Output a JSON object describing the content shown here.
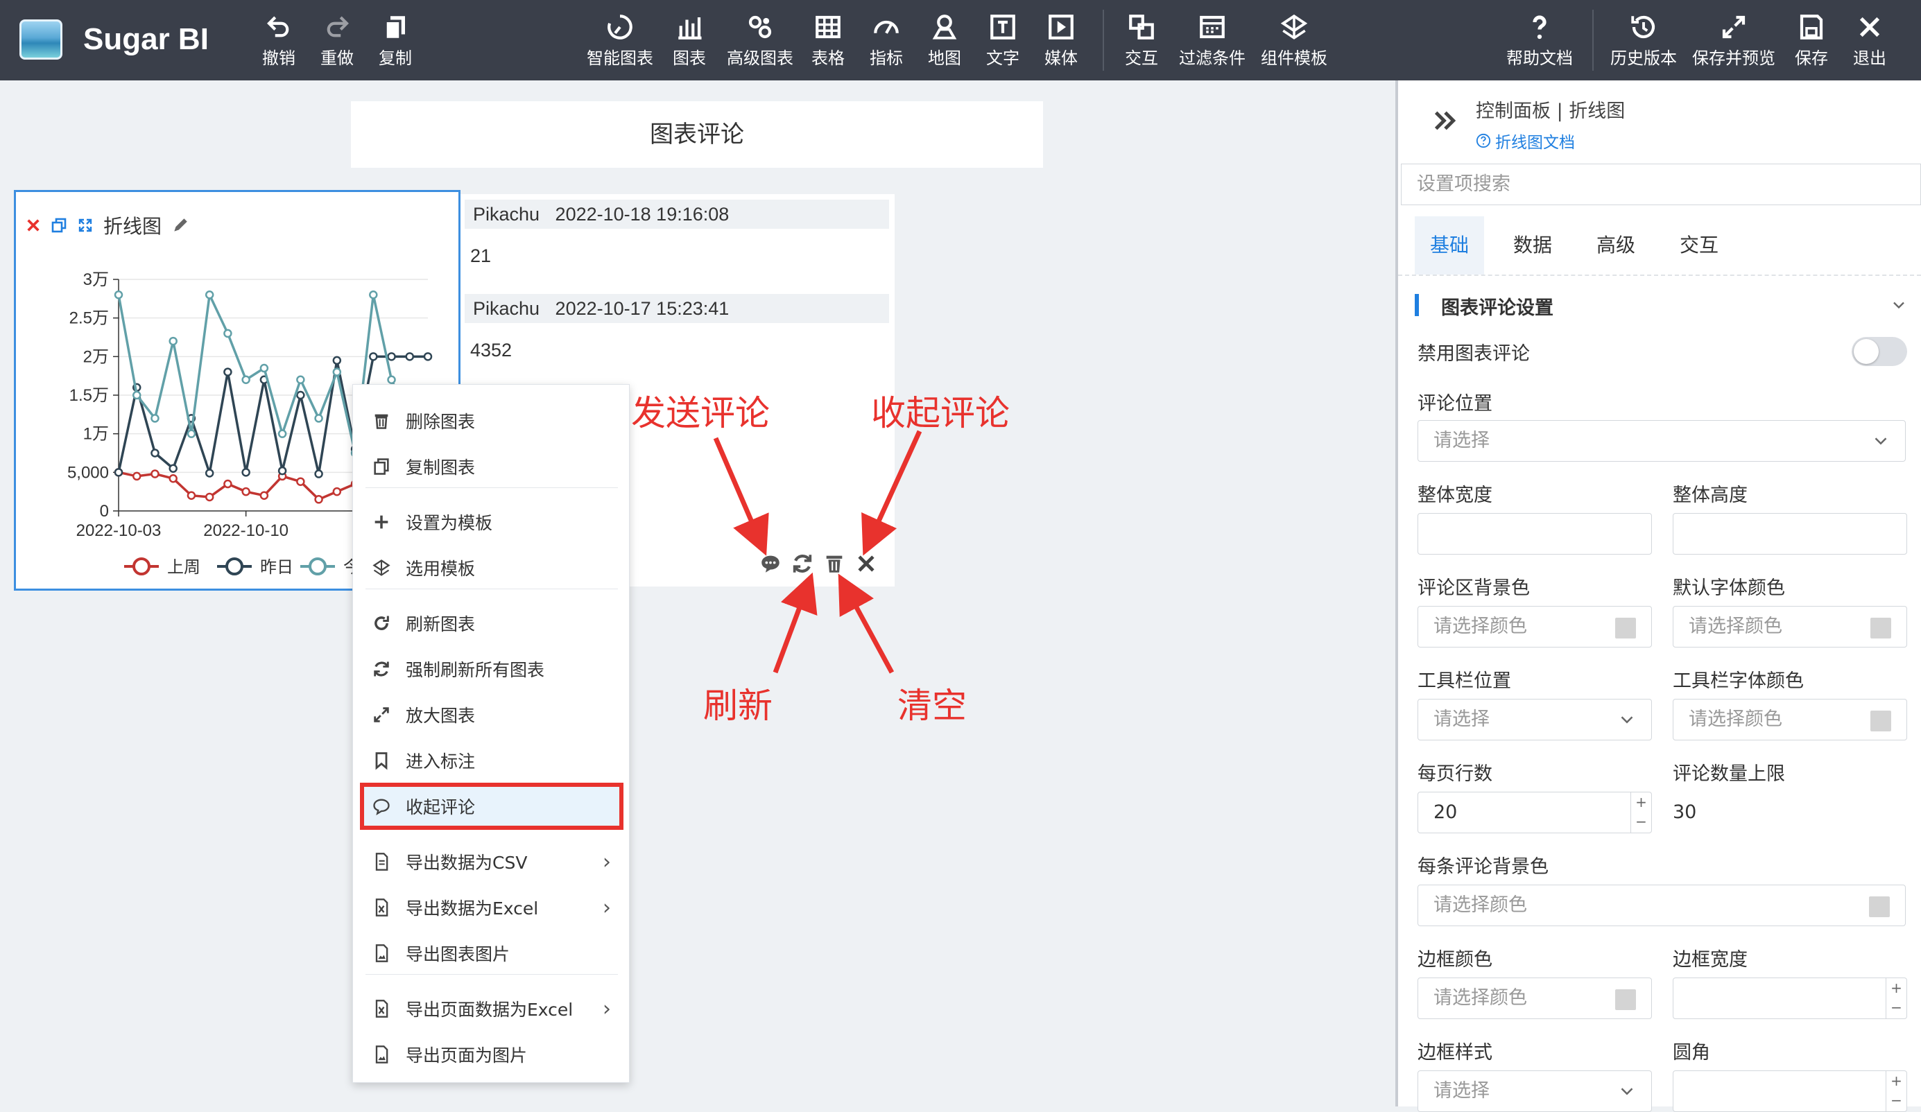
{
  "app": {
    "brand": "Sugar BI"
  },
  "toolbar": {
    "left": [
      {
        "label": "撤销",
        "icon": "undo-icon"
      },
      {
        "label": "重做",
        "icon": "redo-icon"
      },
      {
        "label": "复制",
        "icon": "copy-icon"
      }
    ],
    "center": [
      {
        "label": "智能图表",
        "icon": "smart-chart-icon"
      },
      {
        "label": "图表",
        "icon": "bar-chart-icon"
      },
      {
        "label": "高级图表",
        "icon": "advanced-chart-icon"
      },
      {
        "label": "表格",
        "icon": "table-icon"
      },
      {
        "label": "指标",
        "icon": "gauge-icon"
      },
      {
        "label": "地图",
        "icon": "map-pin-icon"
      },
      {
        "label": "文字",
        "icon": "text-icon"
      },
      {
        "label": "媒体",
        "icon": "media-play-icon"
      }
    ],
    "center2": [
      {
        "label": "交互",
        "icon": "interaction-icon"
      },
      {
        "label": "过滤条件",
        "icon": "filter-icon"
      },
      {
        "label": "组件模板",
        "icon": "template-icon"
      }
    ],
    "right": [
      {
        "label": "帮助文档",
        "icon": "help-icon"
      },
      {
        "label": "历史版本",
        "icon": "history-icon"
      },
      {
        "label": "保存并预览",
        "icon": "expand-icon"
      },
      {
        "label": "保存",
        "icon": "save-icon"
      },
      {
        "label": "退出",
        "icon": "close-icon"
      }
    ]
  },
  "canvas": {
    "title": "图表评论"
  },
  "chart_card": {
    "title": "折线图"
  },
  "chart_data": {
    "type": "line",
    "x_ticks": [
      "2022-10-03",
      "2022-10-10"
    ],
    "y_ticks": [
      "0",
      "5,000",
      "1万",
      "1.5万",
      "2万",
      "2.5万",
      "3万"
    ],
    "ylim": [
      0,
      30000
    ],
    "series": [
      {
        "name": "上周",
        "color": "#c23531",
        "values": [
          5000,
          4500,
          4800,
          4200,
          2000,
          1800,
          3500,
          2500,
          2000,
          4500,
          3800,
          1500,
          2500,
          3500,
          3200,
          1800,
          2200,
          3000
        ]
      },
      {
        "name": "昨日",
        "color": "#2f4554",
        "values": [
          5000,
          16000,
          7500,
          5500,
          12000,
          4900,
          18000,
          5000,
          17000,
          5200,
          15000,
          4800,
          19500,
          8000,
          20000,
          20000,
          20000,
          20000
        ]
      },
      {
        "name": "今日",
        "color": "#61a0a8",
        "values": [
          28000,
          15000,
          12000,
          22000,
          10000,
          28000,
          23000,
          17000,
          18500,
          10000,
          17000,
          12000,
          18000,
          7500,
          28000,
          17000,
          12000,
          12000
        ]
      }
    ],
    "legend": {
      "position": "bottom"
    }
  },
  "comments": [
    {
      "meta": "Pikachu   2022-10-18 19:16:08",
      "body": "21"
    },
    {
      "meta": "Pikachu   2022-10-17 15:23:41",
      "body": "4352"
    }
  ],
  "context_menu": [
    {
      "label": "删除图表",
      "icon": "trash-icon"
    },
    {
      "label": "复制图表",
      "icon": "copy-icon"
    },
    {
      "label": "设置为模板",
      "icon": "plus-icon"
    },
    {
      "label": "选用模板",
      "icon": "template-icon"
    },
    {
      "label": "刷新图表",
      "icon": "refresh-icon"
    },
    {
      "label": "强制刷新所有图表",
      "icon": "sync-icon"
    },
    {
      "label": "放大图表",
      "icon": "expand-icon"
    },
    {
      "label": "进入标注",
      "icon": "bookmark-icon"
    },
    {
      "label": "收起评论",
      "icon": "comment-icon"
    },
    {
      "label": "导出数据为CSV",
      "icon": "file-icon"
    },
    {
      "label": "导出数据为Excel",
      "icon": "excel-file-icon"
    },
    {
      "label": "导出图表图片",
      "icon": "image-file-icon"
    },
    {
      "label": "导出页面数据为Excel",
      "icon": "excel-file-icon"
    },
    {
      "label": "导出页面为图片",
      "icon": "image-file-icon"
    }
  ],
  "annotations": {
    "send": "发送评论",
    "collapse": "收起评论",
    "refresh": "刷新",
    "clear": "清空"
  },
  "sidebar": {
    "title": "控制面板 | 折线图",
    "doc_link": "折线图文档",
    "search_placeholder": "设置项搜索",
    "tabs": [
      "基础",
      "数据",
      "高级",
      "交互"
    ],
    "section_title": "图表评论设置",
    "disable_label": "禁用图表评论",
    "position_label": "评论位置",
    "select_placeholder": "请选择",
    "width_label": "整体宽度",
    "height_label": "整体高度",
    "bg_label": "评论区背景色",
    "font_color_label": "默认字体颜色",
    "color_placeholder": "请选择颜色",
    "toolbar_pos_label": "工具栏位置",
    "toolbar_font_label": "工具栏字体颜色",
    "rows_label": "每页行数",
    "rows_value": "20",
    "max_label": "评论数量上限",
    "max_value": "30",
    "item_bg_label": "每条评论背景色",
    "border_color_label": "边框颜色",
    "border_width_label": "边框宽度",
    "border_style_label": "边框样式",
    "radius_label": "圆角"
  }
}
